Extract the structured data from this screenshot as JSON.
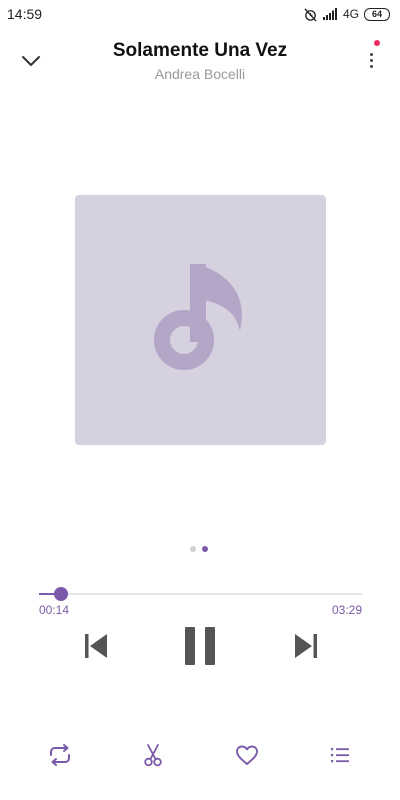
{
  "status_bar": {
    "time": "14:59",
    "network": "4G",
    "battery": "64",
    "icons": [
      "alarm-off-icon",
      "signal-icon",
      "battery-icon"
    ]
  },
  "header": {
    "title": "Solamente Una Vez",
    "artist": "Andrea Bocelli",
    "collapse_icon": "chevron-down-icon",
    "more_icon": "more-vertical-icon",
    "has_notification": true
  },
  "album_art": {
    "icon": "music-note-icon",
    "background": "#d5d1de",
    "note_color": "#b3a6c7"
  },
  "pager": {
    "count": 2,
    "active_index": 1,
    "active_color": "#7a5aa8",
    "inactive_color": "#d0d0d0"
  },
  "player": {
    "current_time": "00:14",
    "total_time": "03:29",
    "progress_fraction": 0.067,
    "accent": "#7a5aa8"
  },
  "controls": {
    "previous_icon": "skip-previous-icon",
    "pause_icon": "pause-icon",
    "next_icon": "skip-next-icon",
    "control_color": "#555555"
  },
  "bottom_bar": {
    "icons": [
      "repeat-icon",
      "scissors-icon",
      "heart-icon",
      "playlist-icon"
    ],
    "icon_color": "#7a5aa8"
  }
}
